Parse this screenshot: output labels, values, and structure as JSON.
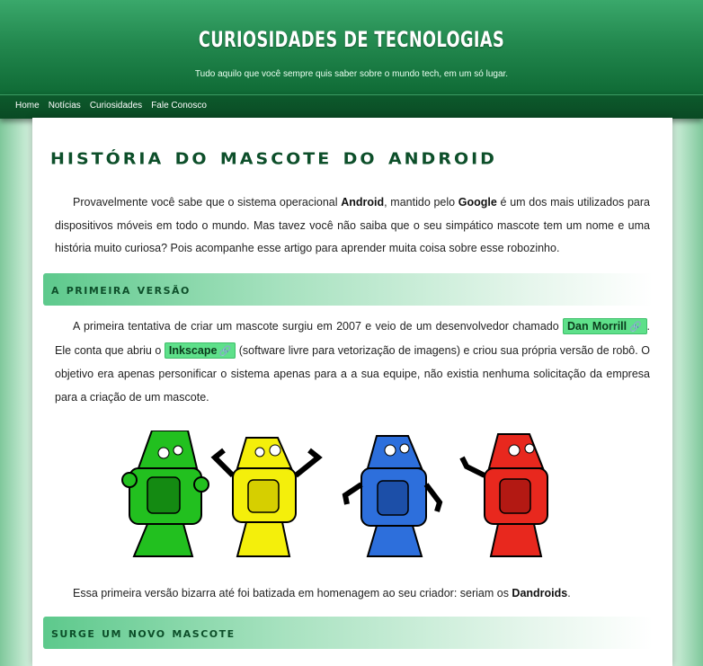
{
  "header": {
    "title": "CURIOSIDADES DE TECNOLOGIAS",
    "subtitle": "Tudo aquilo que você sempre quis saber sobre o mundo tech, em um só lugar."
  },
  "nav": {
    "items": [
      "Home",
      "Notícias",
      "Curiosidades",
      "Fale Conosco"
    ]
  },
  "article": {
    "title": "História do Mascote do Android",
    "intro": {
      "t1": "Provavelmente você sabe que o sistema operacional ",
      "b1": "Android",
      "t2": ", mantido pelo ",
      "b2": "Google",
      "t3": " é um dos mais utilizados para dispositivos móveis em todo o mundo. Mas tavez você não saiba que o seu simpático mascote tem um nome e uma história muito curiosa? Pois acompanhe esse artigo para aprender muita coisa sobre esse robozinho."
    },
    "section1": {
      "heading": "A primeira versão",
      "p1_t1": "A primeira tentativa de criar um mascote surgiu em 2007 e veio de um desenvolvedor chamado ",
      "link1": "Dan Morrill",
      "p1_t2": ". Ele conta que abriu o ",
      "link2": "Inkscape",
      "p1_t3": " (software livre para vetorização de imagens) e criou sua própria versão de robô. O objetivo era apenas personificar o sistema apenas para a a sua equipe, não existia nenhuma solicitação da empresa para a criação de um mascote.",
      "p2_t1": "Essa primeira versão bizarra até foi batizada em homenagem ao seu criador: seriam os ",
      "p2_b1": "Dandroids",
      "p2_t2": "."
    },
    "section2": {
      "heading": "Surge um novo mascote"
    },
    "robot_colors": [
      "#22c01f",
      "#f4ef0b",
      "#2d6fdc",
      "#e8281e"
    ],
    "link_icon": "paperclip-icon"
  }
}
